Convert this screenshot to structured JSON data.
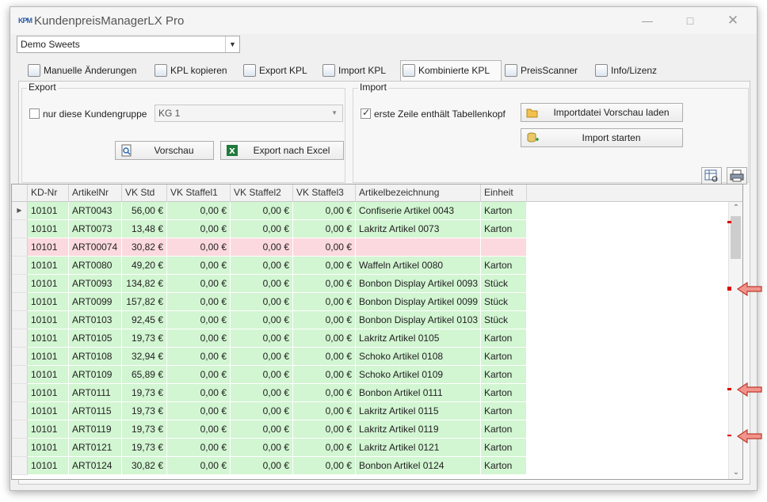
{
  "window": {
    "title": "KundenpreisManagerLX Pro",
    "app_icon_text": "KPM"
  },
  "customer_select": {
    "value": "Demo Sweets"
  },
  "tabs": [
    {
      "label": "Manuelle Änderungen",
      "icon": "edit-icon"
    },
    {
      "label": "KPL kopieren",
      "icon": "copy-icon"
    },
    {
      "label": "Export KPL",
      "icon": "export-icon"
    },
    {
      "label": "Import KPL",
      "icon": "import-icon"
    },
    {
      "label": "Kombinierte KPL",
      "icon": "combine-icon",
      "active": true
    },
    {
      "label": "PreisScanner",
      "icon": "scanner-icon"
    },
    {
      "label": "Info/Lizenz",
      "icon": "info-icon"
    }
  ],
  "export": {
    "title": "Export",
    "only_group_label": "nur diese Kundengruppe",
    "only_group_checked": false,
    "group_value": "KG 1",
    "preview_label": "Vorschau",
    "excel_label": "Export nach Excel"
  },
  "import": {
    "title": "Import",
    "header_label": "erste Zeile enthält Tabellenkopf",
    "header_checked": true,
    "load_preview_label": "Importdatei Vorschau laden",
    "start_label": "Import starten"
  },
  "colors": {
    "green_row": "#d2f5d2",
    "red_row": "#fcd9de",
    "marker": "#e00000"
  },
  "grid": {
    "columns": [
      "KD-Nr",
      "ArtikelNr",
      "VK Std",
      "VK Staffel1",
      "VK Staffel2",
      "VK Staffel3",
      "Artikelbezeichnung",
      "Einheit"
    ],
    "rows": [
      {
        "status": "ok",
        "selected": true,
        "cells": [
          "10101",
          "ART0043",
          "56,00 €",
          "0,00 €",
          "0,00 €",
          "0,00 €",
          "Confiserie Artikel 0043",
          "Karton"
        ]
      },
      {
        "status": "ok",
        "cells": [
          "10101",
          "ART0073",
          "13,48 €",
          "0,00 €",
          "0,00 €",
          "0,00 €",
          "Lakritz Artikel 0073",
          "Karton"
        ]
      },
      {
        "status": "error",
        "cells": [
          "10101",
          "ART00074",
          "30,82 €",
          "0,00 €",
          "0,00 €",
          "0,00 €",
          "",
          ""
        ]
      },
      {
        "status": "ok",
        "cells": [
          "10101",
          "ART0080",
          "49,20 €",
          "0,00 €",
          "0,00 €",
          "0,00 €",
          "Waffeln Artikel 0080",
          "Karton"
        ]
      },
      {
        "status": "ok",
        "cells": [
          "10101",
          "ART0093",
          "134,82 €",
          "0,00 €",
          "0,00 €",
          "0,00 €",
          "Bonbon Display  Artikel 0093",
          "Stück"
        ]
      },
      {
        "status": "ok",
        "cells": [
          "10101",
          "ART0099",
          "157,82 €",
          "0,00 €",
          "0,00 €",
          "0,00 €",
          "Bonbon Display  Artikel 0099",
          "Stück"
        ]
      },
      {
        "status": "ok",
        "cells": [
          "10101",
          "ART0103",
          "92,45 €",
          "0,00 €",
          "0,00 €",
          "0,00 €",
          "Bonbon Display  Artikel 0103",
          "Stück"
        ]
      },
      {
        "status": "ok",
        "cells": [
          "10101",
          "ART0105",
          "19,73 €",
          "0,00 €",
          "0,00 €",
          "0,00 €",
          "Lakritz Artikel 0105",
          "Karton"
        ]
      },
      {
        "status": "ok",
        "cells": [
          "10101",
          "ART0108",
          "32,94 €",
          "0,00 €",
          "0,00 €",
          "0,00 €",
          "Schoko Artikel 0108",
          "Karton"
        ]
      },
      {
        "status": "ok",
        "cells": [
          "10101",
          "ART0109",
          "65,89 €",
          "0,00 €",
          "0,00 €",
          "0,00 €",
          "Schoko Artikel 0109",
          "Karton"
        ]
      },
      {
        "status": "ok",
        "cells": [
          "10101",
          "ART0111",
          "19,73 €",
          "0,00 €",
          "0,00 €",
          "0,00 €",
          "Bonbon Artikel 0111",
          "Karton"
        ]
      },
      {
        "status": "ok",
        "cells": [
          "10101",
          "ART0115",
          "19,73 €",
          "0,00 €",
          "0,00 €",
          "0,00 €",
          "Lakritz Artikel 0115",
          "Karton"
        ]
      },
      {
        "status": "ok",
        "cells": [
          "10101",
          "ART0119",
          "19,73 €",
          "0,00 €",
          "0,00 €",
          "0,00 €",
          "Lakritz Artikel 0119",
          "Karton"
        ]
      },
      {
        "status": "ok",
        "cells": [
          "10101",
          "ART0121",
          "19,73 €",
          "0,00 €",
          "0,00 €",
          "0,00 €",
          "Lakritz Artikel 0121",
          "Karton"
        ]
      },
      {
        "status": "ok",
        "cells": [
          "10101",
          "ART0124",
          "30,82 €",
          "0,00 €",
          "0,00 €",
          "0,00 €",
          "Bonbon Artikel 0124",
          "Karton"
        ]
      }
    ]
  }
}
